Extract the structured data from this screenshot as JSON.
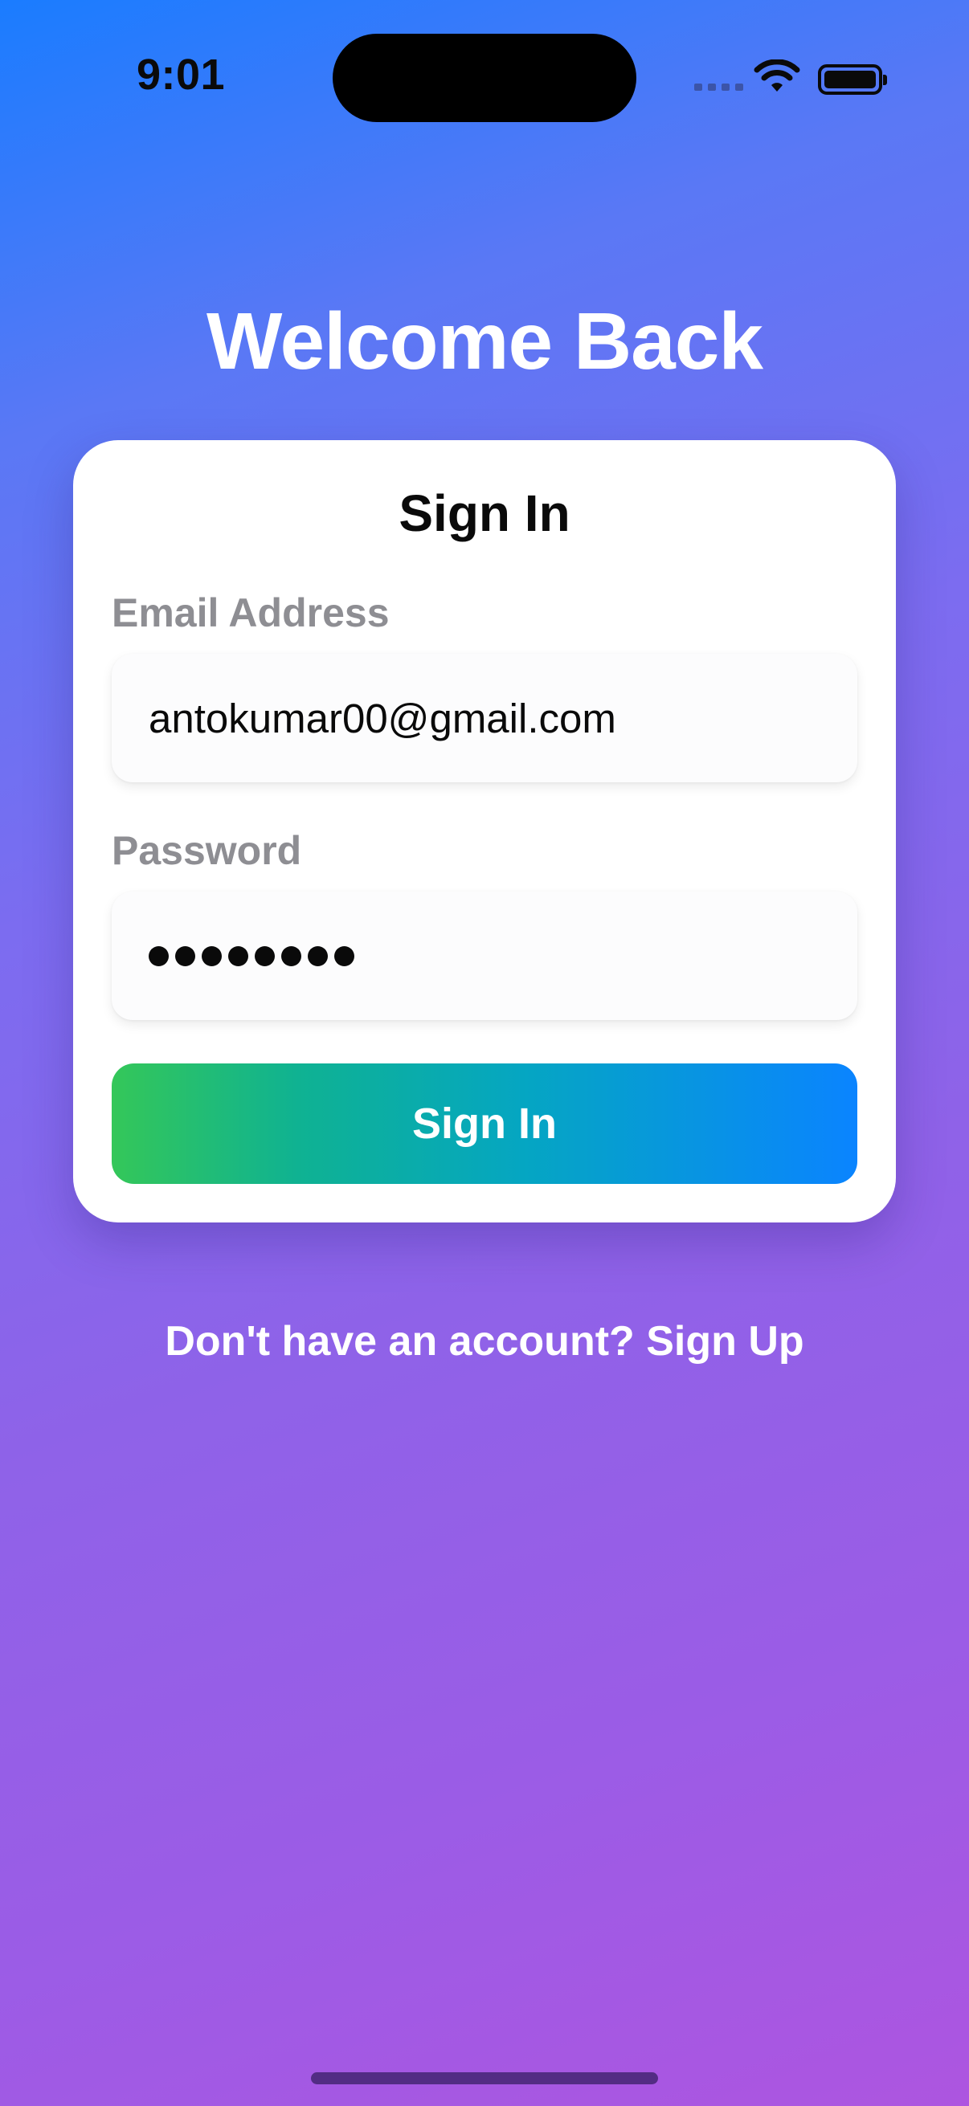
{
  "status_bar": {
    "time": "9:01",
    "icons": [
      "signal-icon",
      "wifi-icon",
      "battery-icon"
    ]
  },
  "header": {
    "title": "Welcome Back"
  },
  "card": {
    "title": "Sign In",
    "email": {
      "label": "Email Address",
      "value": "antokumar00@gmail.com"
    },
    "password": {
      "label": "Password",
      "masked_length": 8
    },
    "submit_label": "Sign In"
  },
  "footer": {
    "signup_prompt": "Don't have an account? Sign Up"
  },
  "colors": {
    "background_top": "#1a7cff",
    "background_bottom": "#ad55e0",
    "button_start": "#34c759",
    "button_end": "#0a84ff",
    "label_gray": "#8e8e93"
  }
}
